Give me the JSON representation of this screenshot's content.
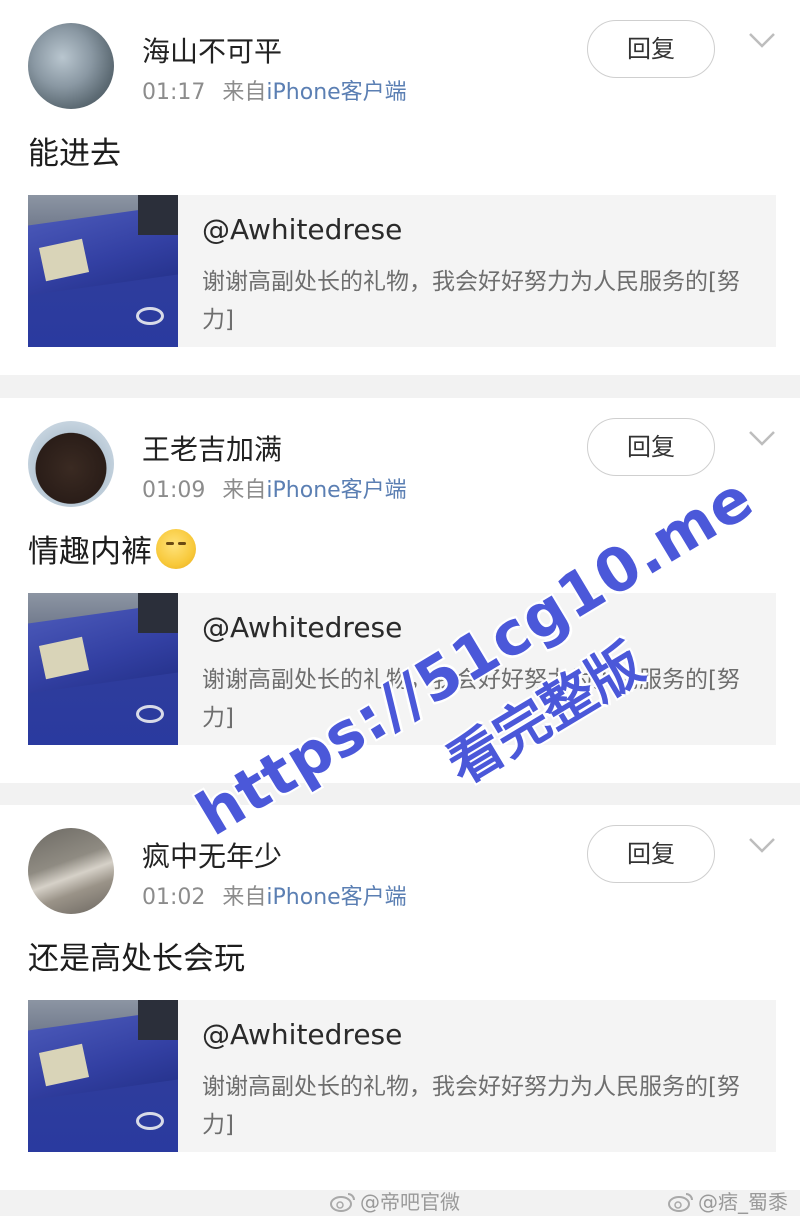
{
  "reply_label": "回复",
  "colors": {
    "source_link": "#5b7fb3",
    "watermark": "#4b58d9"
  },
  "icons": {
    "more": "chevron-down-icon",
    "emoji": "shush-face-emoji-icon",
    "footer": "weibo-icon"
  },
  "comments": [
    {
      "username": "海山不可平",
      "time": "01:17",
      "via": "来自",
      "source": "iPhone客户端",
      "text": "能进去",
      "quote": {
        "handle": "@Awhitedrese",
        "text": "谢谢高副处长的礼物，我会好好努力为人民服务的[努力]"
      }
    },
    {
      "username": "王老吉加满",
      "time": "01:09",
      "via": "来自",
      "source": "iPhone客户端",
      "text": "情趣内裤",
      "quote": {
        "handle": "@Awhitedrese",
        "text": "谢谢高副处长的礼物，我会好好努力为人民服务的[努力]"
      }
    },
    {
      "username": "疯中无年少",
      "time": "01:02",
      "via": "来自",
      "source": "iPhone客户端",
      "text": "还是高处长会玩",
      "quote": {
        "handle": "@Awhitedrese",
        "text": "谢谢高副处长的礼物，我会好好努力为人民服务的[努力]"
      }
    }
  ],
  "watermark": {
    "line1": "https://51cg10.me",
    "line2": "看完整版"
  },
  "footer": {
    "left": "@帝吧官微",
    "right": "@痞_蜀黍"
  }
}
